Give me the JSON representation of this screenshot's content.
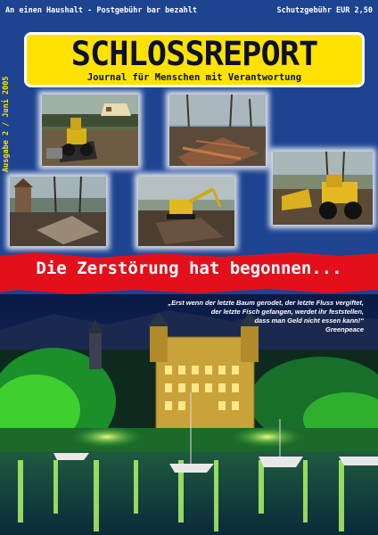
{
  "header": {
    "address_line": "An einen Haushalt - Postgebühr bar bezahlt",
    "fee_line": "Schutzgebühr EUR 2,50"
  },
  "banner": {
    "title": "SCHLOSSREPORT",
    "subtitle": "Journal für Menschen mit Verantwortung"
  },
  "issue": "Ausgabe 2 / Juni 2005",
  "headline": "Die Zerstörung hat begonnen...",
  "quote": {
    "lines": [
      "„Erst wenn der letzte Baum gerodet, der letzte Fluss vergiftet,",
      "der letzte Fisch gefangen, werdet ihr feststellen,",
      "dass man Geld nicht essen kann!“"
    ],
    "source": "Greenpeace"
  },
  "colors": {
    "background": "#1d4391",
    "banner": "#ffe200",
    "headline_strip": "#e3101b"
  }
}
